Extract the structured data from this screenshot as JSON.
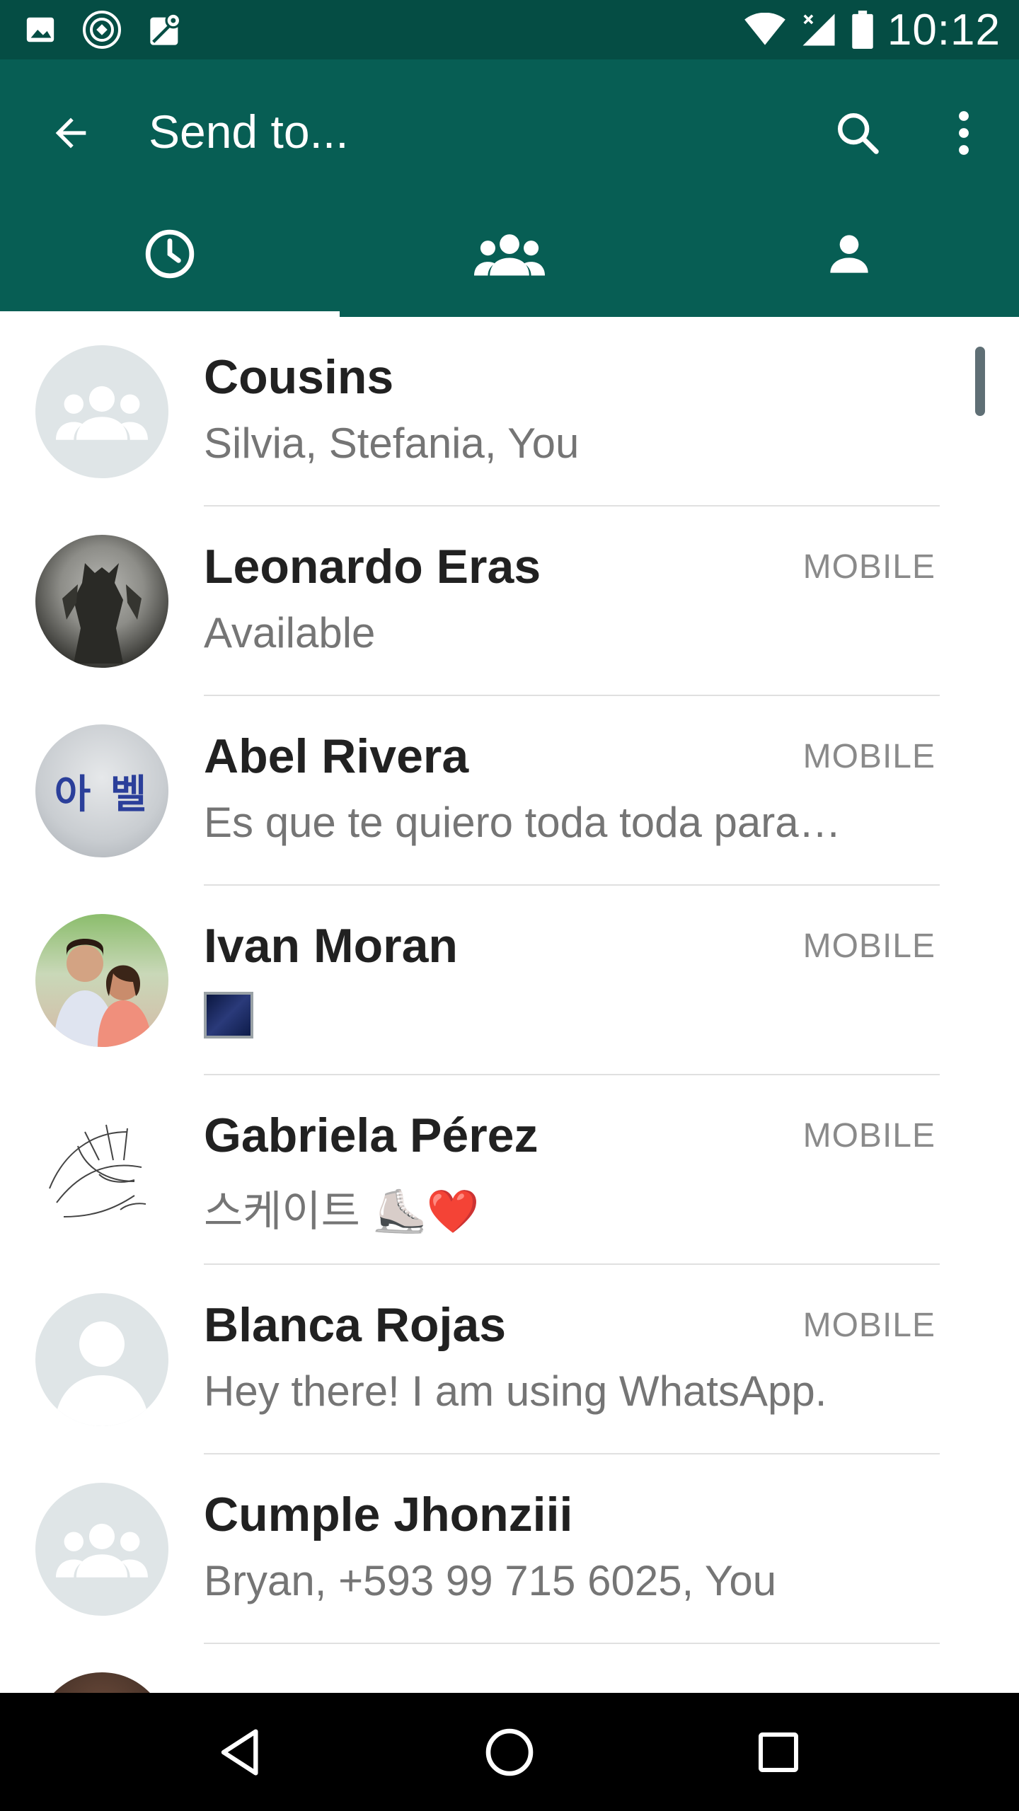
{
  "status_bar": {
    "time": "10:12",
    "icons": [
      "image-icon",
      "target-icon",
      "map-icon",
      "wifi-icon",
      "signal-icon",
      "battery-icon"
    ]
  },
  "toolbar": {
    "title": "Send to...",
    "back_icon": "arrow-left-icon",
    "search_icon": "search-icon",
    "more_icon": "more-vertical-icon"
  },
  "tabs": [
    {
      "icon": "clock-icon",
      "selected": true
    },
    {
      "icon": "group-icon",
      "selected": false
    },
    {
      "icon": "person-icon",
      "selected": false
    }
  ],
  "contacts": [
    {
      "name": "Cousins",
      "subtitle": "Silvia, Stefania, You",
      "type": "",
      "avatar": "group-placeholder"
    },
    {
      "name": "Leonardo Eras",
      "subtitle": "Available",
      "type": "MOBILE",
      "avatar": "photo-dark-figure"
    },
    {
      "name": "Abel Rivera",
      "subtitle": "Es que te quiero toda toda para…",
      "type": "MOBILE",
      "avatar": "photo-korean-text",
      "avatar_text": "아 벨"
    },
    {
      "name": "Ivan Moran",
      "subtitle": "",
      "type": "MOBILE",
      "avatar": "photo-two-people",
      "subtitle_icon": "image-thumbnail-icon"
    },
    {
      "name": "Gabriela Pérez",
      "subtitle": "스케이트 ⛸️❤️",
      "type": "MOBILE",
      "avatar": "photo-sketch"
    },
    {
      "name": "Blanca Rojas",
      "subtitle": "Hey there! I am using WhatsApp.",
      "type": "MOBILE",
      "avatar": "person-placeholder"
    },
    {
      "name": "Cumple Jhonziii",
      "subtitle": "Bryan, +593 99 715 6025, You",
      "type": "",
      "avatar": "group-placeholder"
    }
  ],
  "nav_bar": {
    "back_icon": "nav-back-icon",
    "home_icon": "nav-home-icon",
    "recents_icon": "nav-recents-icon"
  },
  "colors": {
    "status_bar": "#054d44",
    "app_bar": "#075e54",
    "name_text": "#212121",
    "subtitle_text": "#757575"
  }
}
